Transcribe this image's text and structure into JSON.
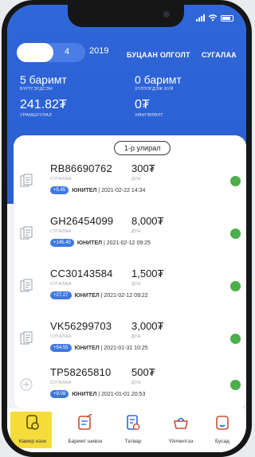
{
  "header": {
    "toggle_value": "4",
    "year": "2019",
    "tab_returns": "БУЦААН ОЛГОЛТ",
    "tab_shelf": "СУГАЛАА",
    "more_icon": "dots-vertical-icon"
  },
  "stats": {
    "registered_value": "5 баримт",
    "registered_label": "БҮРТГЭГДСЭН",
    "pending_value": "0 баримт",
    "pending_label": "ХҮЛЭЭГДЭЖ БУЙ",
    "reward_value": "241.82₮",
    "reward_label": "УРАМШУУЛАЛ",
    "discount_value": "0₮",
    "discount_label": "ХӨНГӨЛӨЛТ"
  },
  "round_pill": "1-р улирал",
  "receipts": [
    {
      "code": "RB86690762",
      "code_label": "СУГАЛАА",
      "amount": "300₮",
      "amount_label": "ДҮН",
      "chip": "+5.45",
      "vendor": "ЮНИТЕЛ",
      "datetime": "2021-02-22 14:34",
      "icon": "receipt-doc-icon"
    },
    {
      "code": "GH26454099",
      "code_label": "СУГАЛАА",
      "amount": "8,000₮",
      "amount_label": "ДҮН",
      "chip": "+145.45",
      "vendor": "ЮНИТЕЛ",
      "datetime": "2021-02-12 09:25",
      "icon": "receipt-doc-icon"
    },
    {
      "code": "CC30143584",
      "code_label": "СУГАЛАА",
      "amount": "1,500₮",
      "amount_label": "ДҮН",
      "chip": "+27.27",
      "vendor": "ЮНИТЕЛ",
      "datetime": "2021-02-12 09:22",
      "icon": "receipt-doc-icon"
    },
    {
      "code": "VK56299703",
      "code_label": "СУГАЛАА",
      "amount": "3,000₮",
      "amount_label": "ДҮН",
      "chip": "+54.55",
      "vendor": "ЮНИТЕЛ",
      "datetime": "2021-01-31 10:25",
      "icon": "receipt-doc-icon"
    },
    {
      "code": "TP58265810",
      "code_label": "СУГАЛАА",
      "amount": "500₮",
      "amount_label": "ДҮН",
      "chip": "+9.09",
      "vendor": "ЮНИТЕЛ",
      "datetime": "2021-01-01 20:53",
      "icon": "plus-circle-icon"
    }
  ],
  "nav": [
    {
      "label": "Камер нээх",
      "icon": "camera-scan-icon",
      "active": true
    },
    {
      "label": "Баримт шивэх",
      "icon": "edit-document-icon",
      "active": false
    },
    {
      "label": "Татвар",
      "icon": "tax-document-icon",
      "active": false
    },
    {
      "label": "Үйлчилгээ",
      "icon": "service-basket-icon",
      "active": false
    },
    {
      "label": "Бусад",
      "icon": "other-document-icon",
      "active": false
    }
  ],
  "colors": {
    "brand_blue": "#2f66d8",
    "chip_blue": "#3f78e2",
    "status_green": "#4cae4c",
    "active_yellow": "#f5dc3a"
  }
}
